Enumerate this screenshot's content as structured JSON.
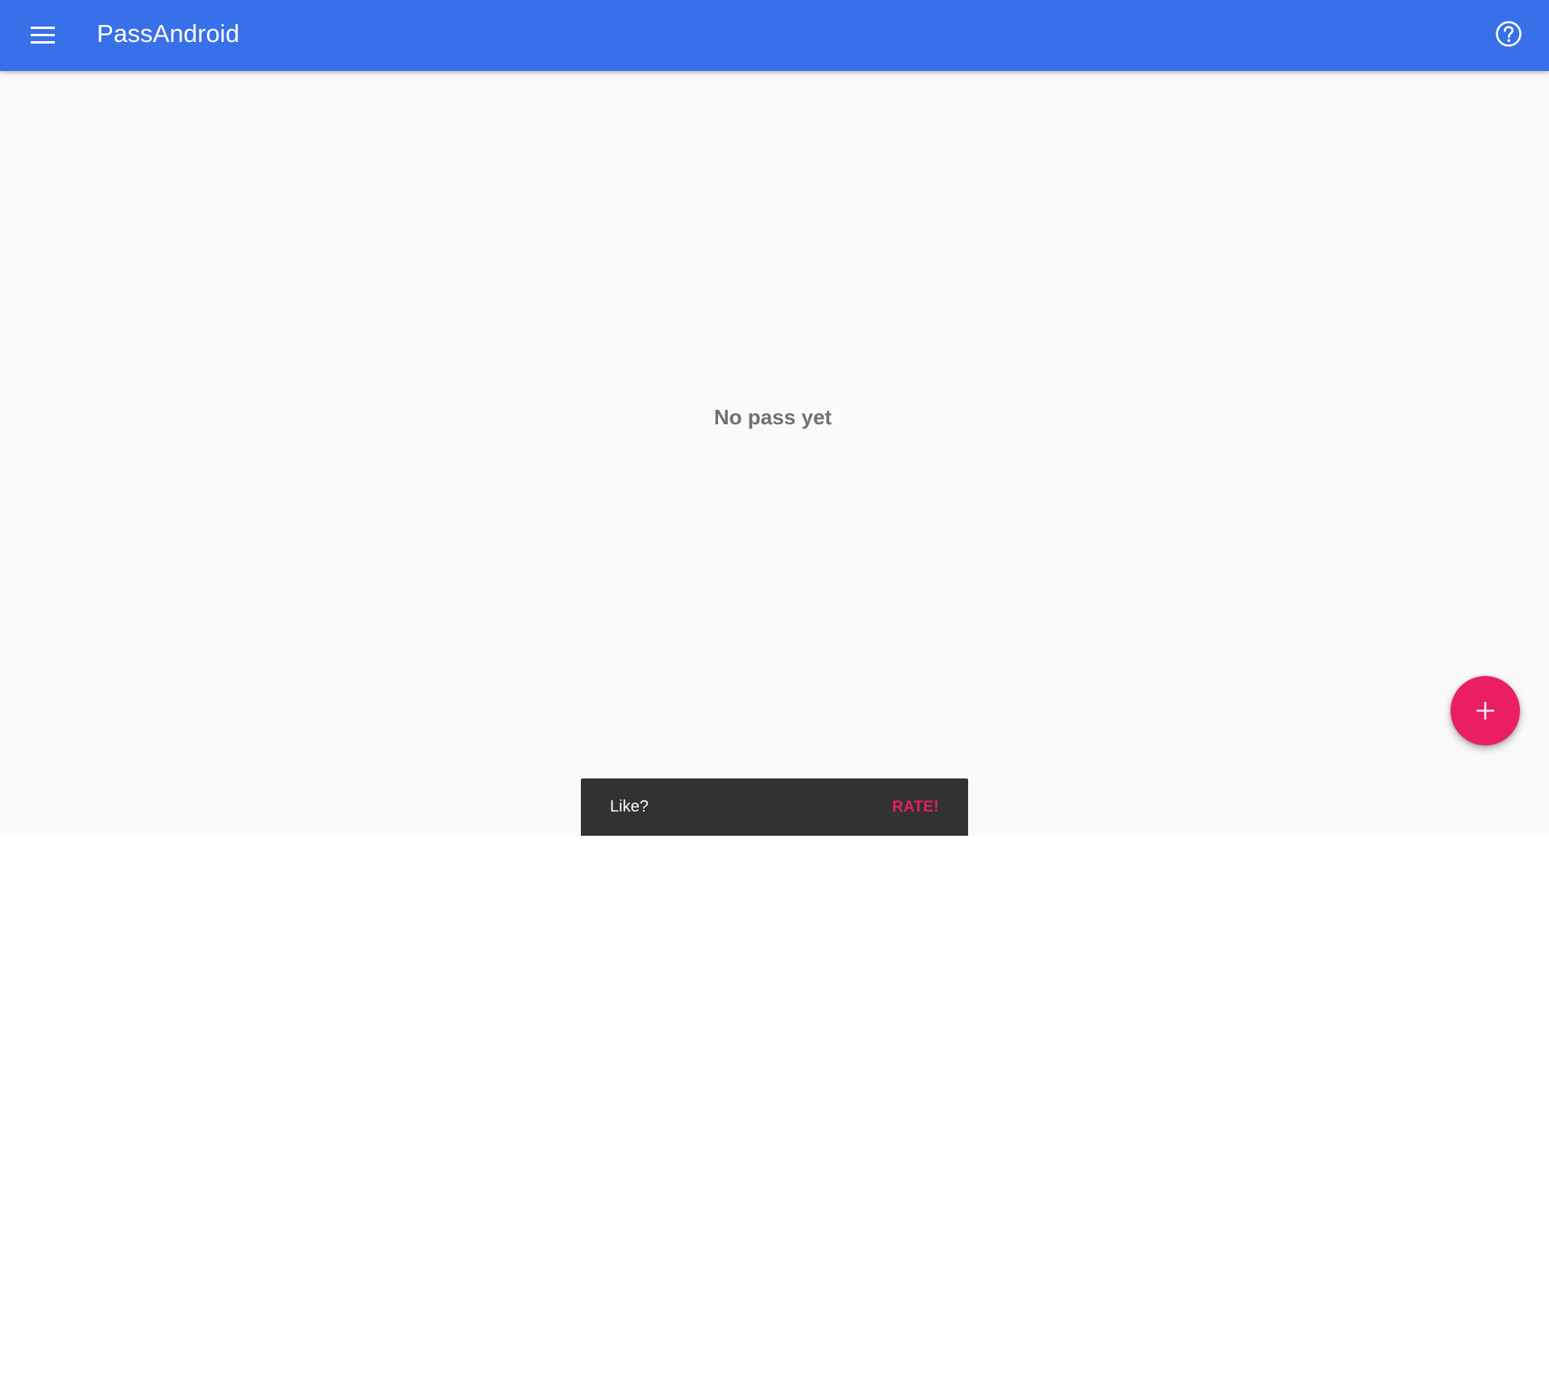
{
  "toolbar": {
    "title": "PassAndroid",
    "menu_icon": "hamburger-menu-icon",
    "help_icon": "help-circle-icon",
    "color": "#3870ea"
  },
  "main": {
    "empty_message": "No pass yet",
    "background": "#fafafa"
  },
  "fab": {
    "icon": "plus-icon",
    "color": "#e91e63"
  },
  "snackbar": {
    "message": "Like?",
    "action": "RATE!",
    "action_color": "#e91e63"
  }
}
